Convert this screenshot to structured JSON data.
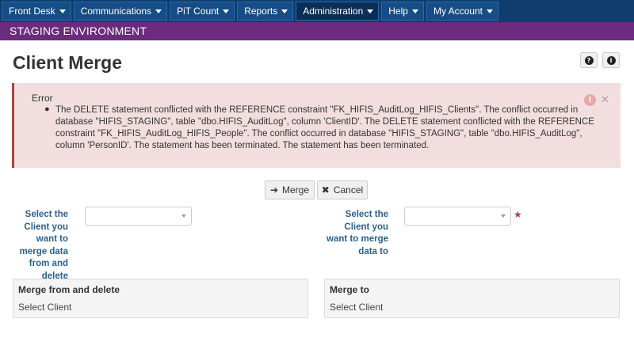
{
  "nav": {
    "items": [
      {
        "label": "Front Desk"
      },
      {
        "label": "Communications"
      },
      {
        "label": "PiT Count"
      },
      {
        "label": "Reports"
      },
      {
        "label": "Administration"
      },
      {
        "label": "Help"
      },
      {
        "label": "My Account"
      }
    ]
  },
  "environment": "STAGING ENVIRONMENT",
  "page": {
    "title": "Client Merge"
  },
  "header_icons": [
    "question-circle-icon",
    "info-circle-icon"
  ],
  "error": {
    "title": "Error",
    "message": "The DELETE statement conflicted with the REFERENCE constraint \"FK_HIFIS_AuditLog_HIFIS_Clients\". The conflict occurred in database \"HIFIS_STAGING\", table \"dbo.HIFIS_AuditLog\", column 'ClientID'. The DELETE statement conflicted with the REFERENCE constraint \"FK_HIFIS_AuditLog_HIFIS_People\". The conflict occurred in database \"HIFIS_STAGING\", table \"dbo.HIFIS_AuditLog\", column 'PersonID'. The statement has been terminated. The statement has been terminated."
  },
  "actions": {
    "merge_label": "Merge",
    "cancel_label": "Cancel"
  },
  "form": {
    "from_label": "Select the Client you want to merge data from and delete",
    "to_label": "Select the Client you want to merge data to",
    "from_value": "",
    "to_value": ""
  },
  "panels": {
    "from_title": "Merge from and delete",
    "from_value": "Select Client",
    "to_title": "Merge to",
    "to_value": "Select Client"
  },
  "colors": {
    "nav_bg": "#0f3d6e",
    "env_bg": "#6b2b7e",
    "error_bg": "#f2dede",
    "error_border": "#a94442",
    "label_color": "#2c5f8a"
  }
}
